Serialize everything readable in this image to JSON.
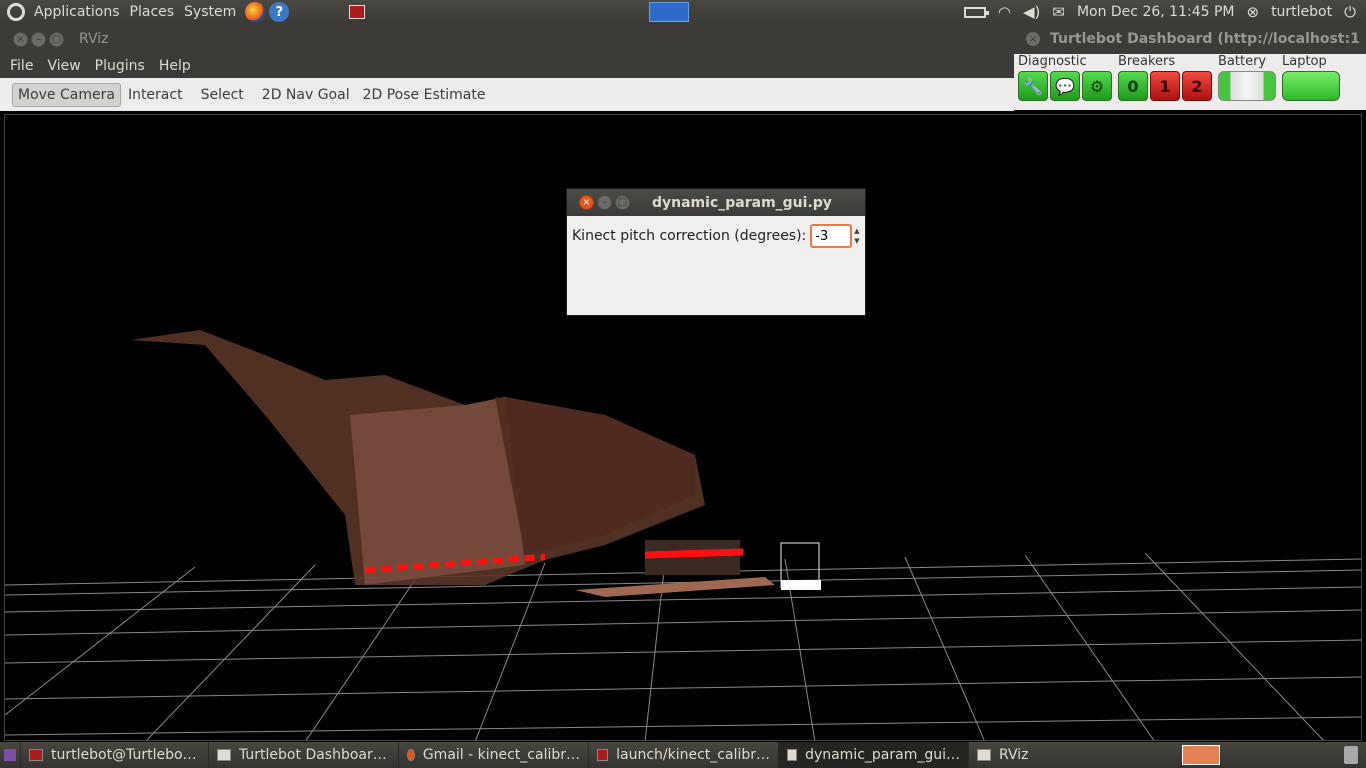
{
  "top_panel": {
    "menus": [
      "Applications",
      "Places",
      "System"
    ],
    "clock": "Mon Dec 26, 11:45 PM",
    "user": "turtlebot"
  },
  "rviz": {
    "title": "RViz",
    "menu": [
      "File",
      "View",
      "Plugins",
      "Help"
    ],
    "tools": [
      "Move Camera",
      "Interact",
      "Select",
      "2D Nav Goal",
      "2D Pose Estimate"
    ],
    "active_tool": "Move Camera"
  },
  "dashboard": {
    "title": "Turtlebot Dashboard (http://localhost:1",
    "groups": {
      "diagnostic": "Diagnostic",
      "breakers": "Breakers",
      "battery": "Battery",
      "laptop": "Laptop"
    },
    "breaker_labels": [
      "0",
      "1",
      "2"
    ],
    "colors": {
      "ok": "#2fb52a",
      "off": "#b01010"
    }
  },
  "dialog": {
    "title": "dynamic_param_gui.py",
    "label": "Kinect pitch correction (degrees):",
    "value": "-3"
  },
  "taskbar": {
    "items": [
      {
        "label": "turtlebot@Turtlebo…",
        "icon": "terminal-icon"
      },
      {
        "label": "Turtlebot Dashboar…",
        "icon": "window-icon"
      },
      {
        "label": "Gmail - kinect_calibr…",
        "icon": "firefox-icon"
      },
      {
        "label": "launch/kinect_calibr…",
        "icon": "terminal-icon"
      },
      {
        "label": "dynamic_param_gui…",
        "icon": "window-icon"
      },
      {
        "label": "RViz",
        "icon": "window-icon"
      }
    ]
  }
}
